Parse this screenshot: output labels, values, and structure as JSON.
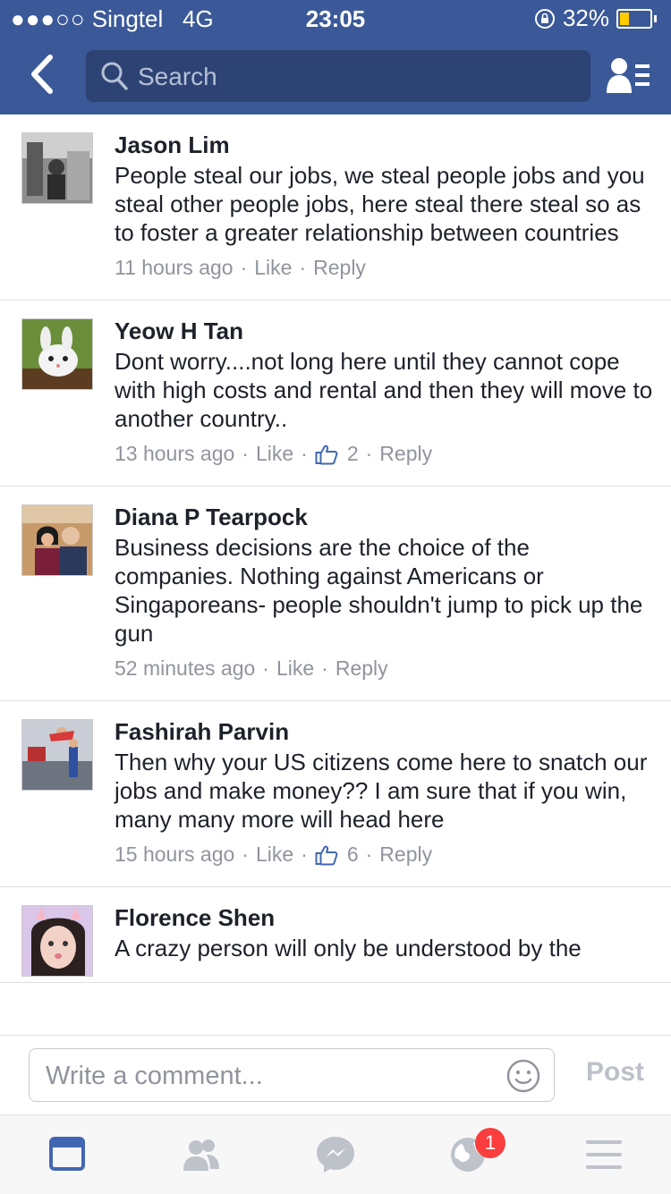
{
  "status_bar": {
    "signal": "●●●○○",
    "carrier": "Singtel",
    "network": "4G",
    "time": "23:05",
    "battery_percent": "32%",
    "battery_level": 0.32
  },
  "navbar": {
    "search_placeholder": "Search"
  },
  "comments": [
    {
      "name": "Jason Lim",
      "text": "People steal our jobs, we steal people jobs and you steal other people jobs, here steal there steal so as to foster a greater relationship between countries",
      "time": "11 hours ago",
      "like_label": "Like",
      "reply_label": "Reply"
    },
    {
      "name": "Yeow H Tan",
      "text": "Dont worry....not long here until they cannot cope with high costs and rental and then they will move to another country..",
      "time": "13 hours ago",
      "like_label": "Like",
      "like_count": "2",
      "reply_label": "Reply"
    },
    {
      "name": "Diana P Tearpock",
      "text": "Business decisions are the choice of the companies. Nothing against Americans or Singaporeans- people shouldn't jump to pick up the gun",
      "time": "52 minutes ago",
      "like_label": "Like",
      "reply_label": "Reply"
    },
    {
      "name": "Fashirah Parvin",
      "text": "Then why your US citizens come here to snatch our jobs and make money?? I am sure that if you win, many many more will head here",
      "time": "15 hours ago",
      "like_label": "Like",
      "like_count": "6",
      "reply_label": "Reply"
    },
    {
      "name": "Florence Shen",
      "text": "A crazy person will only be understood by the"
    }
  ],
  "composer": {
    "placeholder": "Write a comment...",
    "post_label": "Post"
  },
  "tabbar": {
    "notifications_badge": "1"
  },
  "colors": {
    "brand": "#3b5998",
    "search_bg": "#2d4373",
    "active_tab": "#4267b2",
    "inactive_tab": "#bec2c9",
    "badge": "#fa3e3e"
  }
}
